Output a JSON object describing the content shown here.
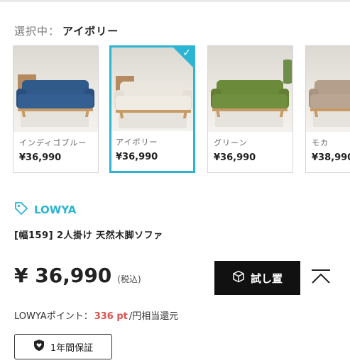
{
  "selection": {
    "label": "選択中：",
    "value": "アイボリー"
  },
  "variants": [
    {
      "name": "インディゴブルー",
      "price": "¥36,990",
      "color": "#2f5a8a",
      "selected": false
    },
    {
      "name": "アイボリー",
      "price": "¥36,990",
      "color": "#ece7de",
      "selected": true
    },
    {
      "name": "グリーン",
      "price": "¥36,990",
      "color": "#6b8a3a",
      "selected": false
    },
    {
      "name": "モカ",
      "price": "¥38,990",
      "color": "#b49f8c",
      "selected": false
    }
  ],
  "product": {
    "brand": "LOWYA",
    "title": "[幅159] 2人掛け 天然木脚ソファ",
    "price": "¥ 36,990",
    "tax_note": "(税込)"
  },
  "actions": {
    "try_label": "試し置"
  },
  "points": {
    "label": "LOWYAポイント：",
    "value": "336 pt",
    "suffix": "/円相当還元"
  },
  "warranty": {
    "label": "1年間保証"
  },
  "colors": {
    "accent": "#2bb5d2",
    "point_red": "#d9534f"
  },
  "icons": {
    "selected": "check-icon",
    "brand": "tag-icon",
    "try": "cube-icon",
    "back_top": "chevron-up-icon",
    "warranty": "shield-heart-icon"
  }
}
